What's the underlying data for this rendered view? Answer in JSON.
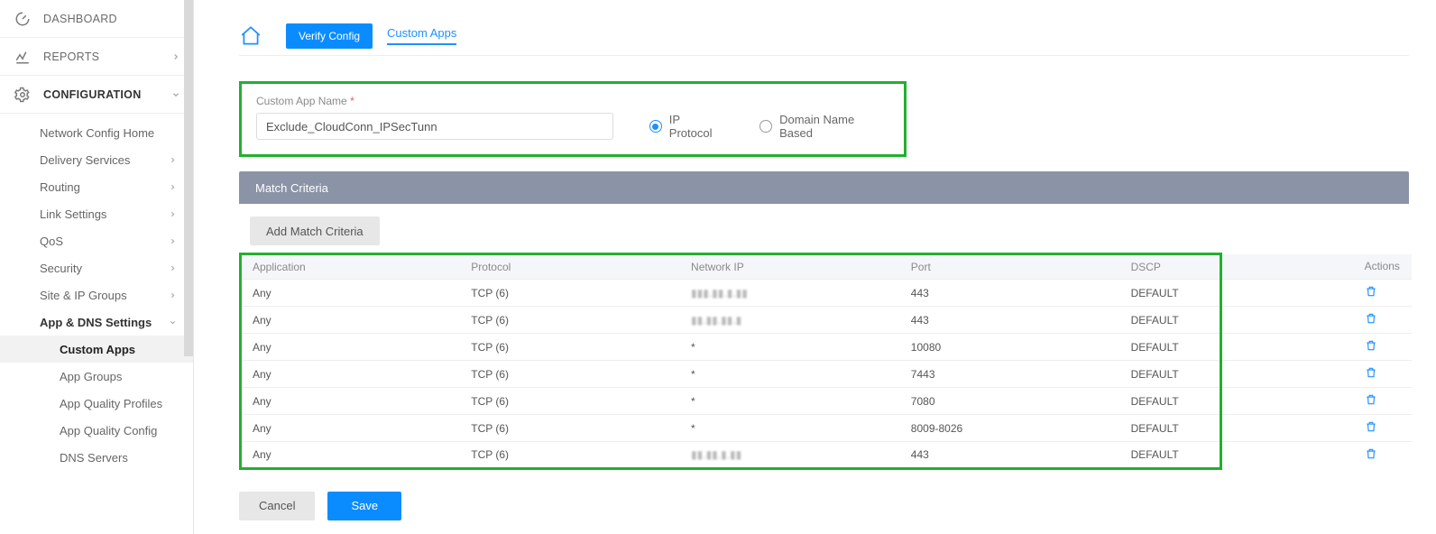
{
  "sidebar": {
    "dashboard": "DASHBOARD",
    "reports": "REPORTS",
    "configuration": "CONFIGURATION",
    "items": [
      "Network Config Home",
      "Delivery Services",
      "Routing",
      "Link Settings",
      "QoS",
      "Security",
      "Site & IP Groups",
      "App & DNS Settings"
    ],
    "leaves": [
      "Custom Apps",
      "App Groups",
      "App Quality Profiles",
      "App Quality Config",
      "DNS Servers"
    ]
  },
  "topbar": {
    "verify": "Verify Config",
    "crumb": "Custom Apps"
  },
  "form": {
    "name_label": "Custom App Name",
    "name_value": "Exclude_CloudConn_IPSecTunn",
    "radio_ip": "IP Protocol",
    "radio_dns": "Domain Name Based"
  },
  "match": {
    "header": "Match Criteria",
    "add": "Add Match Criteria"
  },
  "table": {
    "cols": [
      "Application",
      "Protocol",
      "Network IP",
      "Port",
      "DSCP",
      "Actions"
    ],
    "rows": [
      {
        "app": "Any",
        "proto": "TCP (6)",
        "ip": "▮▮▮.▮▮.▮.▮▮",
        "port": "443",
        "dscp": "DEFAULT"
      },
      {
        "app": "Any",
        "proto": "TCP (6)",
        "ip": "▮▮.▮▮.▮▮.▮",
        "port": "443",
        "dscp": "DEFAULT"
      },
      {
        "app": "Any",
        "proto": "TCP (6)",
        "ip": "*",
        "port": "10080",
        "dscp": "DEFAULT"
      },
      {
        "app": "Any",
        "proto": "TCP (6)",
        "ip": "*",
        "port": "7443",
        "dscp": "DEFAULT"
      },
      {
        "app": "Any",
        "proto": "TCP (6)",
        "ip": "*",
        "port": "7080",
        "dscp": "DEFAULT"
      },
      {
        "app": "Any",
        "proto": "TCP (6)",
        "ip": "*",
        "port": "8009-8026",
        "dscp": "DEFAULT"
      },
      {
        "app": "Any",
        "proto": "TCP (6)",
        "ip": "▮▮.▮▮.▮.▮▮",
        "port": "443",
        "dscp": "DEFAULT"
      }
    ]
  },
  "footer": {
    "cancel": "Cancel",
    "save": "Save"
  }
}
